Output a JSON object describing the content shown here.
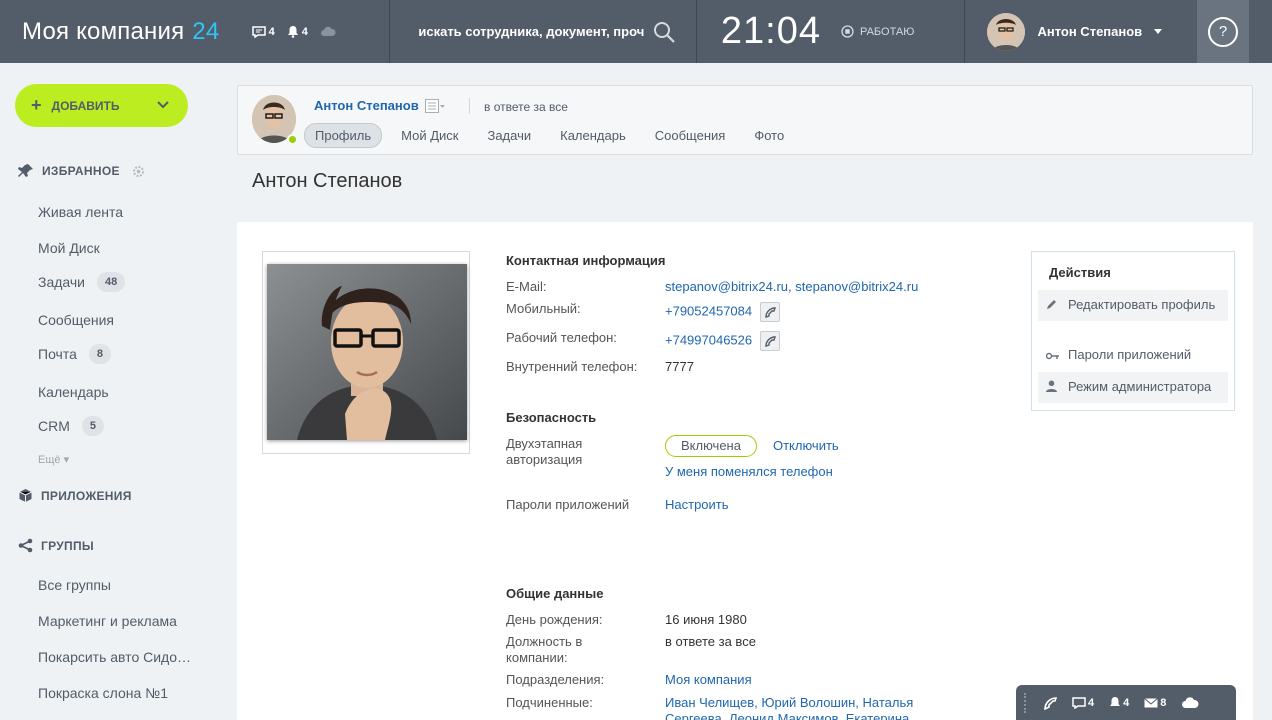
{
  "header": {
    "logo_text": "Моя компания",
    "logo_num": "24",
    "chat_count": "4",
    "notify_count": "4",
    "search_placeholder": "искать сотрудника, документ, прочее",
    "time": "21:04",
    "work_status": "РАБОТАЮ",
    "user_name": "Антон Степанов",
    "help_icon": "?"
  },
  "sidebar": {
    "add_label": "ДОБАВИТЬ",
    "favorites_title": "ИЗБРАННОЕ",
    "items": [
      {
        "label": "Живая лента",
        "badge": ""
      },
      {
        "label": "Мой Диск",
        "badge": ""
      },
      {
        "label": "Задачи",
        "badge": "48"
      },
      {
        "label": "Сообщения",
        "badge": ""
      },
      {
        "label": "Почта",
        "badge": "8"
      },
      {
        "label": "Календарь",
        "badge": ""
      },
      {
        "label": "CRM",
        "badge": "5"
      }
    ],
    "more_label": "Ещё",
    "apps_title": "ПРИЛОЖЕНИЯ",
    "groups_title": "ГРУППЫ",
    "groups": [
      "Все группы",
      "Маркетинг и реклама",
      "Покарсить авто Сидо…",
      "Покраска слона №1"
    ]
  },
  "profile_card": {
    "name": "Антон Степанов",
    "role": "в ответе за все",
    "tabs": [
      "Профиль",
      "Мой Диск",
      "Задачи",
      "Календарь",
      "Сообщения",
      "Фото"
    ]
  },
  "page_title": "Антон Степанов",
  "contact": {
    "title": "Контактная информация",
    "email_label": "E-Mail:",
    "email_value": "stepanov@bitrix24.ru, stepanov@bitrix24.ru",
    "mobile_label": "Мобильный:",
    "mobile_value": "+79052457084",
    "work_label": "Рабочий телефон:",
    "work_value": "+74997046526",
    "internal_label": "Внутренний телефон:",
    "internal_value": "7777"
  },
  "security": {
    "title": "Безопасность",
    "twofa_label": "Двухэтапная авторизация",
    "twofa_status": "Включена",
    "twofa_disable": "Отключить",
    "phone_changed": "У меня поменялся телефон",
    "app_pass_label": "Пароли приложений",
    "app_pass_link": "Настроить"
  },
  "general": {
    "title": "Общие данные",
    "birthday_label": "День рождения:",
    "birthday_value": "16 июня 1980",
    "position_label": "Должность в компании:",
    "position_value": "в ответе за все",
    "dept_label": "Подразделения:",
    "dept_value": "Моя компания",
    "subs_label": "Подчиненные:",
    "subs_value": "Иван Челищев, Юрий Волошин, Наталья",
    "subs_value2": "Сергеева, Леонид Максимов, Екатерина"
  },
  "actions": {
    "title": "Действия",
    "edit": "Редактировать профиль",
    "app_passwords": "Пароли приложений",
    "admin_mode": "Режим администратора"
  },
  "bottom_bar": {
    "chat_count": "4",
    "notify_count": "4",
    "mail_count": "8"
  },
  "colors": {
    "header_bg": "#535c69",
    "accent_green": "#bbed21",
    "link_blue": "#2067b0",
    "logo_blue": "#2fc6f6"
  }
}
